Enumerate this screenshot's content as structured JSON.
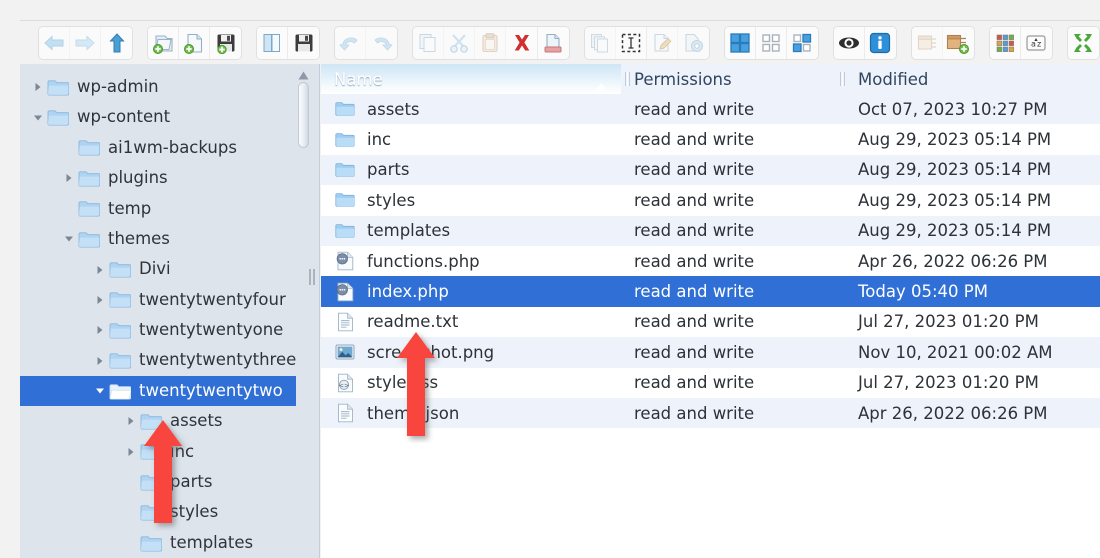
{
  "toolbar": {
    "groups": [
      {
        "name": "navigation",
        "buttons": [
          {
            "id": "back",
            "label": "Back",
            "icon": "arrow-left-icon",
            "disabled": true
          },
          {
            "id": "forward",
            "label": "Forward",
            "icon": "arrow-right-icon",
            "disabled": true
          },
          {
            "id": "up",
            "label": "Up one level",
            "icon": "arrow-up-icon",
            "disabled": false
          }
        ]
      },
      {
        "name": "create",
        "buttons": [
          {
            "id": "new-folder",
            "label": "New Folder",
            "icon": "new-folder-icon",
            "disabled": false
          },
          {
            "id": "new-file",
            "label": "New File",
            "icon": "new-file-icon",
            "disabled": false
          },
          {
            "id": "save",
            "label": "Save",
            "icon": "save-icon",
            "disabled": false
          }
        ]
      },
      {
        "name": "open",
        "buttons": [
          {
            "id": "open-file",
            "label": "Open",
            "icon": "open-book-icon",
            "disabled": false
          },
          {
            "id": "save-as",
            "label": "Save As",
            "icon": "floppy-disk-icon",
            "disabled": false
          }
        ]
      },
      {
        "name": "history",
        "buttons": [
          {
            "id": "undo",
            "label": "Undo",
            "icon": "undo-icon",
            "disabled": true
          },
          {
            "id": "redo",
            "label": "Redo",
            "icon": "redo-icon",
            "disabled": true
          }
        ]
      },
      {
        "name": "clipboard",
        "buttons": [
          {
            "id": "copy",
            "label": "Copy",
            "icon": "copy-icon",
            "disabled": true
          },
          {
            "id": "cut",
            "label": "Cut",
            "icon": "scissors-icon",
            "disabled": true
          },
          {
            "id": "paste",
            "label": "Paste",
            "icon": "clipboard-icon",
            "disabled": true
          },
          {
            "id": "delete",
            "label": "Delete",
            "icon": "red-x-icon",
            "disabled": false
          },
          {
            "id": "rename",
            "label": "Rename",
            "icon": "rename-file-icon",
            "disabled": false
          }
        ]
      },
      {
        "name": "duplicate",
        "buttons": [
          {
            "id": "duplicate",
            "label": "Duplicate",
            "icon": "duplicate-files-icon",
            "disabled": true
          },
          {
            "id": "select-all",
            "label": "Select All",
            "icon": "marquee-select-icon",
            "disabled": false
          },
          {
            "id": "edit",
            "label": "Edit",
            "icon": "edit-pencil-icon",
            "disabled": true
          },
          {
            "id": "permissions",
            "label": "Permissions",
            "icon": "file-gear-icon",
            "disabled": true
          }
        ]
      },
      {
        "name": "view",
        "buttons": [
          {
            "id": "view-grid",
            "label": "Grid View",
            "icon": "grid-large-icon",
            "disabled": false
          },
          {
            "id": "view-small",
            "label": "Small Icons",
            "icon": "grid-small-icon",
            "disabled": false
          },
          {
            "id": "view-mixed",
            "label": "Mixed View",
            "icon": "grid-mixed-icon",
            "disabled": false
          }
        ]
      },
      {
        "name": "display",
        "buttons": [
          {
            "id": "hidden-files",
            "label": "Show Hidden Files",
            "icon": "eye-icon",
            "disabled": false
          },
          {
            "id": "info",
            "label": "Information",
            "icon": "info-icon",
            "disabled": false
          }
        ]
      },
      {
        "name": "archive",
        "buttons": [
          {
            "id": "extract",
            "label": "Extract Archive",
            "icon": "archive-extract-icon",
            "disabled": true
          },
          {
            "id": "compress",
            "label": "Create Archive",
            "icon": "archive-add-icon",
            "disabled": false
          }
        ]
      },
      {
        "name": "tools",
        "buttons": [
          {
            "id": "apps",
            "label": "Applications",
            "icon": "apps-grid-icon",
            "disabled": false
          },
          {
            "id": "sort",
            "label": "Sort",
            "icon": "sort-az-icon",
            "disabled": false
          }
        ]
      },
      {
        "name": "screen",
        "buttons": [
          {
            "id": "fullscreen",
            "label": "Full Screen",
            "icon": "fullscreen-icon",
            "disabled": false
          }
        ]
      }
    ]
  },
  "tree": {
    "items": [
      {
        "label": "wp-admin",
        "depth": 1,
        "twisty": "collapsed",
        "selected": false
      },
      {
        "label": "wp-content",
        "depth": 1,
        "twisty": "expanded",
        "selected": false
      },
      {
        "label": "ai1wm-backups",
        "depth": 2,
        "twisty": "none",
        "selected": false
      },
      {
        "label": "plugins",
        "depth": 2,
        "twisty": "collapsed",
        "selected": false
      },
      {
        "label": "temp",
        "depth": 2,
        "twisty": "none",
        "selected": false
      },
      {
        "label": "themes",
        "depth": 2,
        "twisty": "expanded",
        "selected": false
      },
      {
        "label": "Divi",
        "depth": 3,
        "twisty": "collapsed",
        "selected": false
      },
      {
        "label": "twentytwentyfour",
        "depth": 3,
        "twisty": "collapsed",
        "selected": false
      },
      {
        "label": "twentytwentyone",
        "depth": 3,
        "twisty": "collapsed",
        "selected": false
      },
      {
        "label": "twentytwentythree",
        "depth": 3,
        "twisty": "collapsed",
        "selected": false
      },
      {
        "label": "twentytwentytwo",
        "depth": 3,
        "twisty": "expanded",
        "selected": true
      },
      {
        "label": "assets",
        "depth": 4,
        "twisty": "collapsed",
        "selected": false
      },
      {
        "label": "inc",
        "depth": 4,
        "twisty": "collapsed",
        "selected": false
      },
      {
        "label": "parts",
        "depth": 4,
        "twisty": "none",
        "selected": false
      },
      {
        "label": "styles",
        "depth": 4,
        "twisty": "none",
        "selected": false
      },
      {
        "label": "templates",
        "depth": 4,
        "twisty": "none",
        "selected": false
      }
    ],
    "scrollbar": {
      "up_arrow_icon": "scroll-up-arrow-icon",
      "thumb": "scroll-thumb"
    },
    "splitter": "panel-splitter-grip"
  },
  "list": {
    "columns": [
      {
        "key": "name",
        "label": "Name",
        "sorted": "ascending",
        "sort_icon": "sort-ascending-icon"
      },
      {
        "key": "permissions",
        "label": "Permissions",
        "sorted": "none"
      },
      {
        "key": "modified",
        "label": "Modified",
        "sorted": "none"
      }
    ],
    "rows": [
      {
        "name": "assets",
        "icon": "folder-icon",
        "permissions": "read and write",
        "modified": "Oct 07, 2023 10:27 PM",
        "selected": false
      },
      {
        "name": "inc",
        "icon": "folder-icon",
        "permissions": "read and write",
        "modified": "Aug 29, 2023 05:14 PM",
        "selected": false
      },
      {
        "name": "parts",
        "icon": "folder-icon",
        "permissions": "read and write",
        "modified": "Aug 29, 2023 05:14 PM",
        "selected": false
      },
      {
        "name": "styles",
        "icon": "folder-icon",
        "permissions": "read and write",
        "modified": "Aug 29, 2023 05:14 PM",
        "selected": false
      },
      {
        "name": "templates",
        "icon": "folder-icon",
        "permissions": "read and write",
        "modified": "Aug 29, 2023 05:14 PM",
        "selected": false
      },
      {
        "name": "functions.php",
        "icon": "php-file-icon",
        "permissions": "read and write",
        "modified": "Apr 26, 2022 06:26 PM",
        "selected": false
      },
      {
        "name": "index.php",
        "icon": "php-file-icon",
        "permissions": "read and write",
        "modified": "Today 05:40 PM",
        "selected": true
      },
      {
        "name": "readme.txt",
        "icon": "text-file-icon",
        "permissions": "read and write",
        "modified": "Jul 27, 2023 01:20 PM",
        "selected": false
      },
      {
        "name": "screenshot.png",
        "icon": "image-file-icon",
        "permissions": "read and write",
        "modified": "Nov 10, 2021 00:02 AM",
        "selected": false
      },
      {
        "name": "style.css",
        "icon": "css-file-icon",
        "permissions": "read and write",
        "modified": "Jul 27, 2023 01:20 PM",
        "selected": false
      },
      {
        "name": "theme.json",
        "icon": "text-file-icon",
        "permissions": "read and write",
        "modified": "Apr 26, 2022 06:26 PM",
        "selected": false
      }
    ]
  },
  "annotations": {
    "color": "#f8443c",
    "arrows": [
      {
        "name": "tree-assets-pointer",
        "points_to": "assets"
      },
      {
        "name": "list-readme-pointer",
        "points_to": "readme.txt"
      }
    ]
  }
}
